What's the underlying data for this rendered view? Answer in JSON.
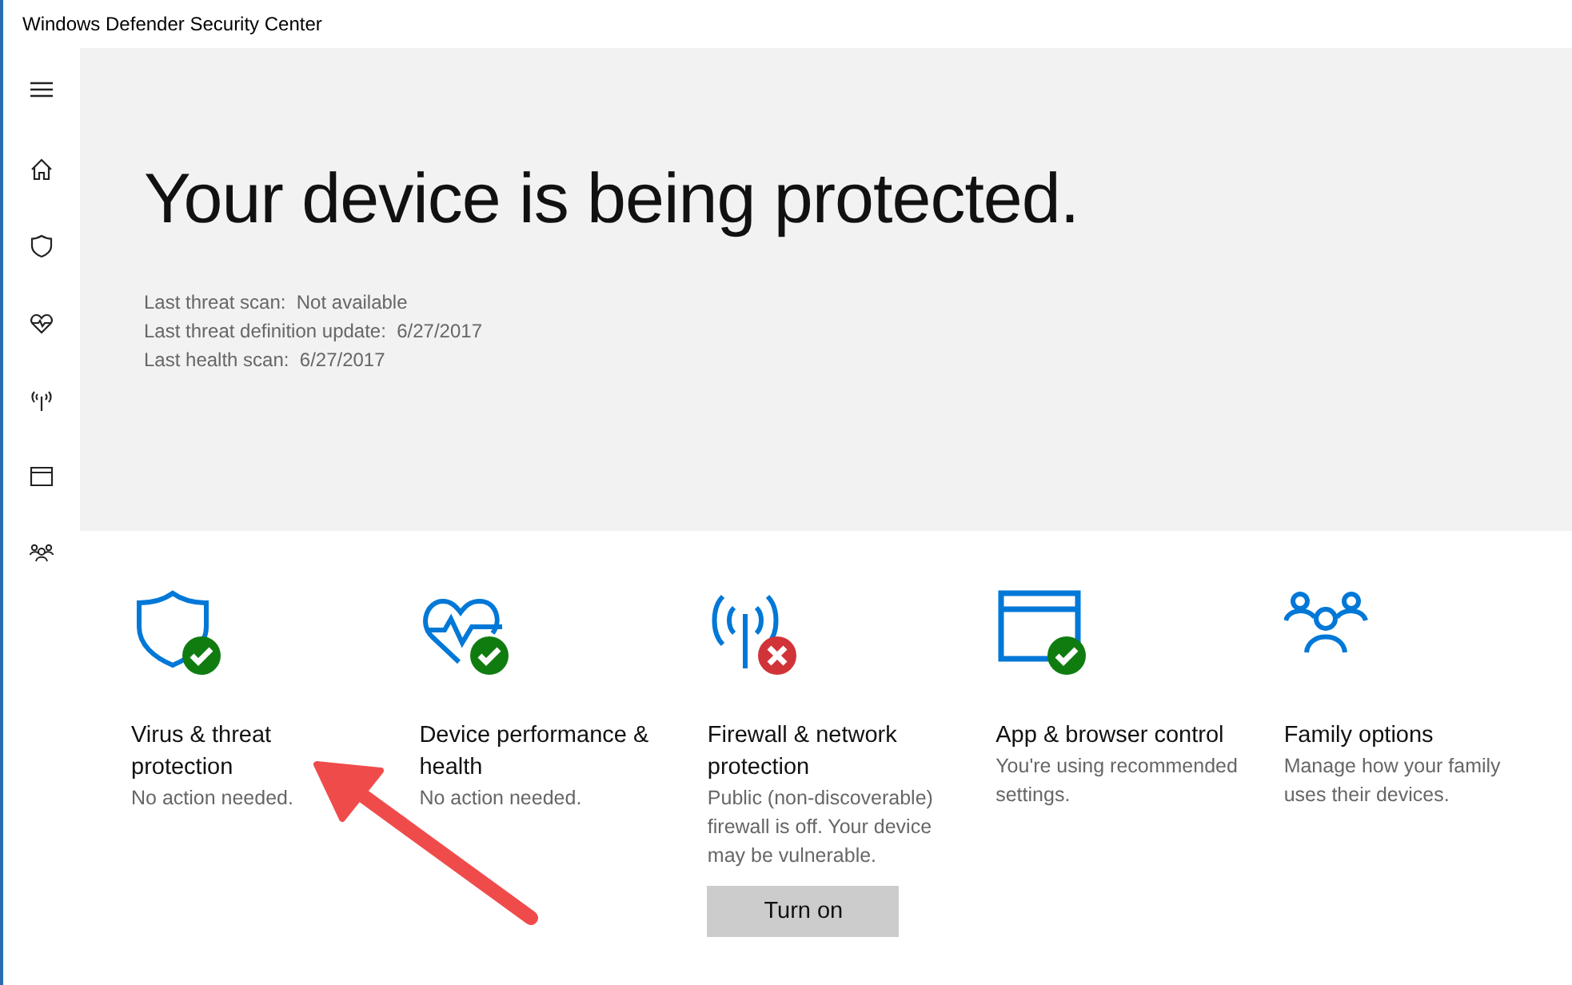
{
  "window": {
    "title": "Windows Defender Security Center"
  },
  "hero": {
    "headline": "Your device is being protected.",
    "details": [
      "Last threat scan:  Not available",
      "Last threat definition update:  6/27/2017",
      "Last health scan:  6/27/2017"
    ]
  },
  "tiles": [
    {
      "title": "Virus & threat protection",
      "description": "No action needed.",
      "badge": true,
      "healthy": true
    },
    {
      "title": "Device performance & health",
      "description": "No action needed.",
      "badge": true,
      "healthy": true
    },
    {
      "title": "Firewall & network protection",
      "description": "Public (non-discoverable) firewall is off. Your device may be vulnerable.",
      "badge": true,
      "healthy": false,
      "button": "Turn on"
    },
    {
      "title": "App & browser control",
      "description": "You're using recommended settings.",
      "badge": true,
      "healthy": true
    },
    {
      "title": "Family options",
      "description": "Manage how your family uses their devices.",
      "badge": false
    }
  ]
}
